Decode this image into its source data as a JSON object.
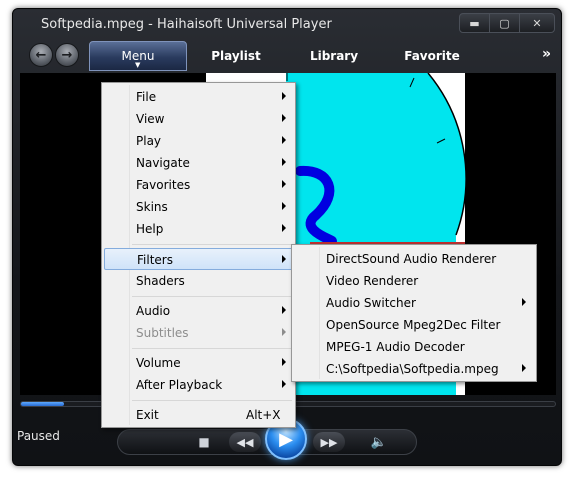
{
  "window": {
    "title": "Softpedia.mpeg - Haihaisoft Universal Player",
    "buttons": {
      "minimize": "▬",
      "maximize": "▢",
      "close": "✕"
    }
  },
  "nav": {
    "back_icon": "back-arrow-icon",
    "forward_icon": "forward-arrow-icon",
    "tabs": [
      {
        "label": "Menu",
        "active": true
      },
      {
        "label": "Playlist"
      },
      {
        "label": "Library"
      },
      {
        "label": "Favorite"
      }
    ],
    "more_label": "»"
  },
  "status": {
    "text": "Paused",
    "progress": 0.08
  },
  "controls": {
    "stop": "■",
    "rewind": "◀◀",
    "play": "▶",
    "forward": "▶▶",
    "volume": "🔈"
  },
  "main_menu": {
    "items": [
      {
        "label": "File",
        "submenu": true
      },
      {
        "label": "View",
        "submenu": true
      },
      {
        "label": "Play",
        "submenu": true
      },
      {
        "label": "Navigate",
        "submenu": true
      },
      {
        "label": "Favorites",
        "submenu": true
      },
      {
        "label": "Skins",
        "submenu": true
      },
      {
        "label": "Help",
        "submenu": true
      },
      {
        "label": "Filters",
        "submenu": true,
        "highlighted": true
      },
      {
        "label": "Shaders"
      },
      {
        "label": "Audio",
        "submenu": true
      },
      {
        "label": "Subtitles",
        "submenu": true,
        "disabled": true
      },
      {
        "label": "Volume",
        "submenu": true
      },
      {
        "label": "After Playback",
        "submenu": true
      },
      {
        "label": "Exit",
        "shortcut": "Alt+X"
      }
    ]
  },
  "filters_menu": {
    "items": [
      {
        "label": "DirectSound Audio Renderer"
      },
      {
        "label": "Video Renderer"
      },
      {
        "label": "Audio Switcher",
        "submenu": true
      },
      {
        "label": "OpenSource Mpeg2Dec Filter"
      },
      {
        "label": "MPEG-1 Audio Decoder"
      },
      {
        "label": "C:\\Softpedia\\Softpedia.mpeg",
        "submenu": true
      }
    ]
  },
  "colors": {
    "video_frame_bg": "#ffffff",
    "dial": "#00e5ee",
    "blue_stroke": "#0000e0",
    "red_hand": "#c03030",
    "menu_highlight": "#cfe3f9"
  }
}
